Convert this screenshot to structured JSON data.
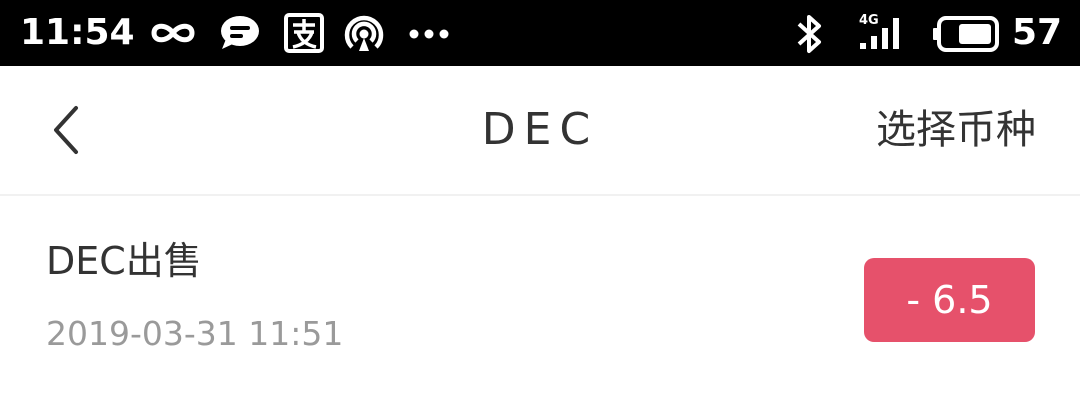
{
  "status_bar": {
    "time": "11:54",
    "network_label": "4G",
    "battery_percent": "57",
    "icons": [
      "infinity-icon",
      "chat-bubble-icon",
      "alipay-icon",
      "hotspot-icon",
      "more-dots-icon",
      "bluetooth-icon",
      "signal-icon",
      "battery-icon"
    ]
  },
  "nav": {
    "back_icon": "chevron-left-icon",
    "title": "DEC",
    "select_coin_label": "选择币种"
  },
  "record": {
    "title": "DEC出售",
    "timestamp": "2019-03-31 11:51",
    "amount": "- 6.5",
    "amount_color": "#e6516b"
  },
  "colors": {
    "status_bar_bg": "#000000",
    "text_primary": "#333333",
    "text_secondary": "#9a9a9a",
    "accent_red": "#e6516b"
  }
}
